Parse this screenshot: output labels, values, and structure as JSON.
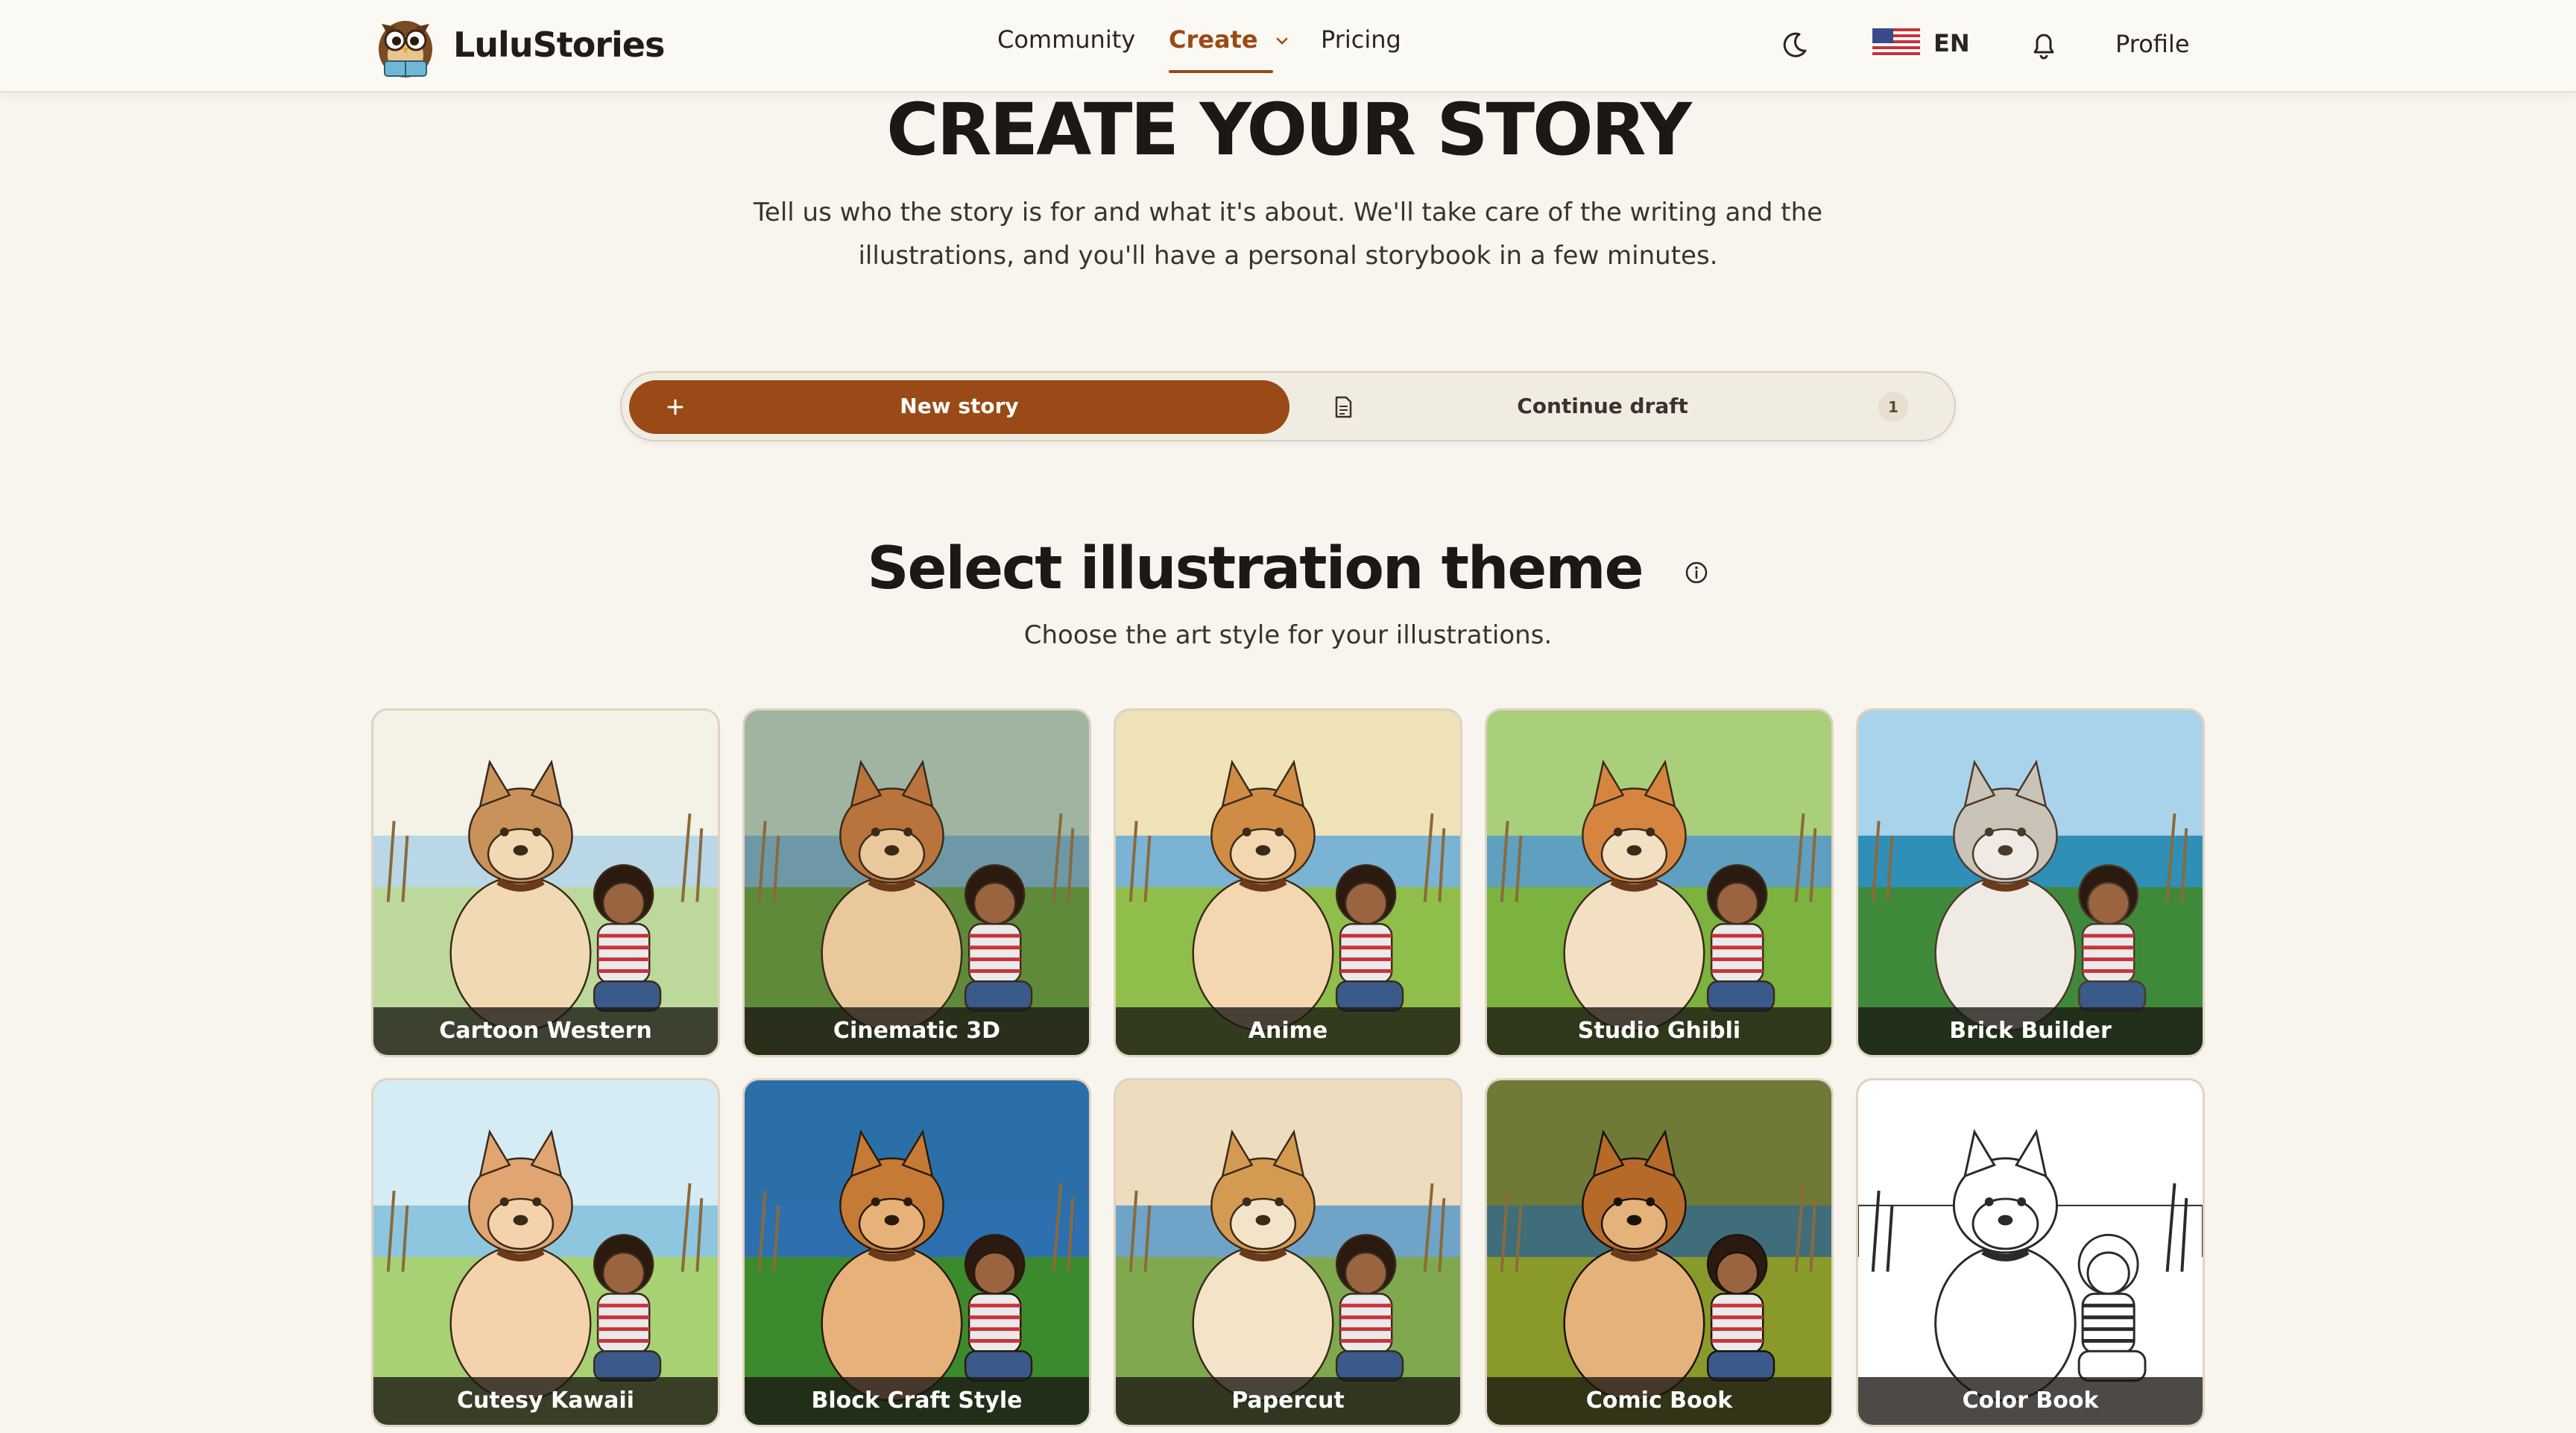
{
  "brand": {
    "name": "LuluStories"
  },
  "nav": {
    "community": "Community",
    "create": "Create",
    "pricing": "Pricing"
  },
  "header": {
    "language_code": "EN",
    "profile": "Profile",
    "icons": [
      "moon-icon",
      "us-flag-icon",
      "bell-icon"
    ]
  },
  "hero": {
    "title": "CREATE YOUR STORY",
    "subtitle_line1": "Tell us who the story is for and what it's about. We'll take care of the writing and the",
    "subtitle_line2": "illustrations, and you'll have a personal storybook in a few minutes."
  },
  "toggle": {
    "new_story": "New story",
    "continue_draft": "Continue draft",
    "draft_count": "1"
  },
  "theme_section": {
    "title": "Select illustration theme",
    "subtitle": "Choose the art style for your illustrations."
  },
  "themes": [
    {
      "label": "Cartoon Western"
    },
    {
      "label": "Cinematic 3D"
    },
    {
      "label": "Anime"
    },
    {
      "label": "Studio Ghibli"
    },
    {
      "label": "Brick Builder"
    },
    {
      "label": "Cutesy Kawaii"
    },
    {
      "label": "Block Craft Style"
    },
    {
      "label": "Papercut"
    },
    {
      "label": "Comic Book"
    },
    {
      "label": "Color Book"
    }
  ],
  "colors": {
    "accent": "#9a4a16",
    "background": "#f8f5ee"
  }
}
